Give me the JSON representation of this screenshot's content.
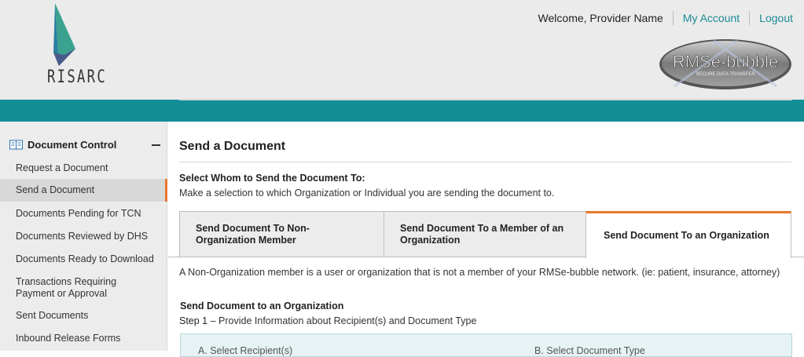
{
  "brand": {
    "logo_text": "RISARC",
    "badge_title": "RMSe-bubble",
    "badge_subtitle": "SECURE DATA TRANSFER"
  },
  "topnav": {
    "welcome": "Welcome, Provider Name",
    "my_account": "My Account",
    "logout": "Logout"
  },
  "sidebar": {
    "section_title": "Document Control",
    "items": [
      {
        "label": "Request a Document"
      },
      {
        "label": "Send a Document",
        "active": true
      },
      {
        "label": "Documents Pending for TCN"
      },
      {
        "label": "Documents Reviewed by DHS"
      },
      {
        "label": "Documents Ready to Download"
      },
      {
        "label": "Transactions Requiring Payment or Approval"
      },
      {
        "label": "Sent Documents"
      },
      {
        "label": "Inbound Release Forms"
      }
    ]
  },
  "main": {
    "title": "Send a Document",
    "select_heading": "Select Whom to Send the Document To:",
    "select_desc": "Make a selection to which Organization or Individual you are sending the document to.",
    "tabs": [
      {
        "label": "Send Document To Non-Organization Member"
      },
      {
        "label": "Send Document To a Member of an Organization"
      },
      {
        "label": "Send Document To an Organization",
        "selected": true
      }
    ],
    "note": "A Non-Organization member is a user or organization that is not a member of your RMSe-bubble network. (ie: patient, insurance, attorney)",
    "section_heading": "Send Document to an Organization",
    "step_label": "Step 1",
    "step_text": " – Provide Information about Recipient(s) and Document Type",
    "panel": {
      "left_label": "A. Select Recipient(s)",
      "right_label": "B. Select Document Type"
    }
  },
  "colors": {
    "teal": "#138e97",
    "accent_orange": "#e8772e",
    "link": "#1a8a96"
  }
}
